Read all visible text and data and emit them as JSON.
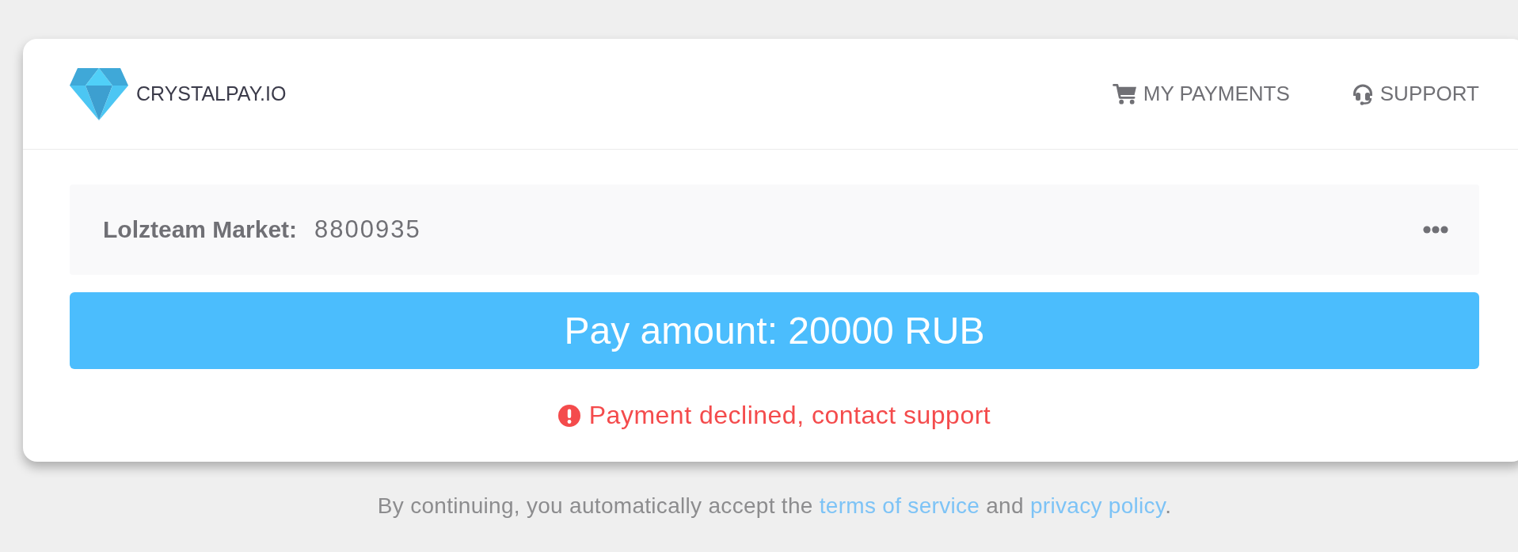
{
  "brand": {
    "name": "CRYSTALPAY.IO"
  },
  "nav": [
    {
      "kind": "cart",
      "label": "MY PAYMENTS"
    },
    {
      "kind": "support",
      "label": "SUPPORT"
    }
  ],
  "merchant": {
    "label": "Lolzteam Market:",
    "value": "8800935"
  },
  "pay_button": {
    "label": "Pay amount: 20000 RUB"
  },
  "status": {
    "kind": "error",
    "message": "Payment declined, contact support"
  },
  "footer": {
    "segments": [
      {
        "kind": "text",
        "text": "By continuing, you automatically accept the "
      },
      {
        "kind": "link",
        "text": "terms of service"
      },
      {
        "kind": "text",
        "text": " and "
      },
      {
        "kind": "link",
        "text": "privacy policy"
      },
      {
        "kind": "text",
        "text": "."
      }
    ]
  }
}
